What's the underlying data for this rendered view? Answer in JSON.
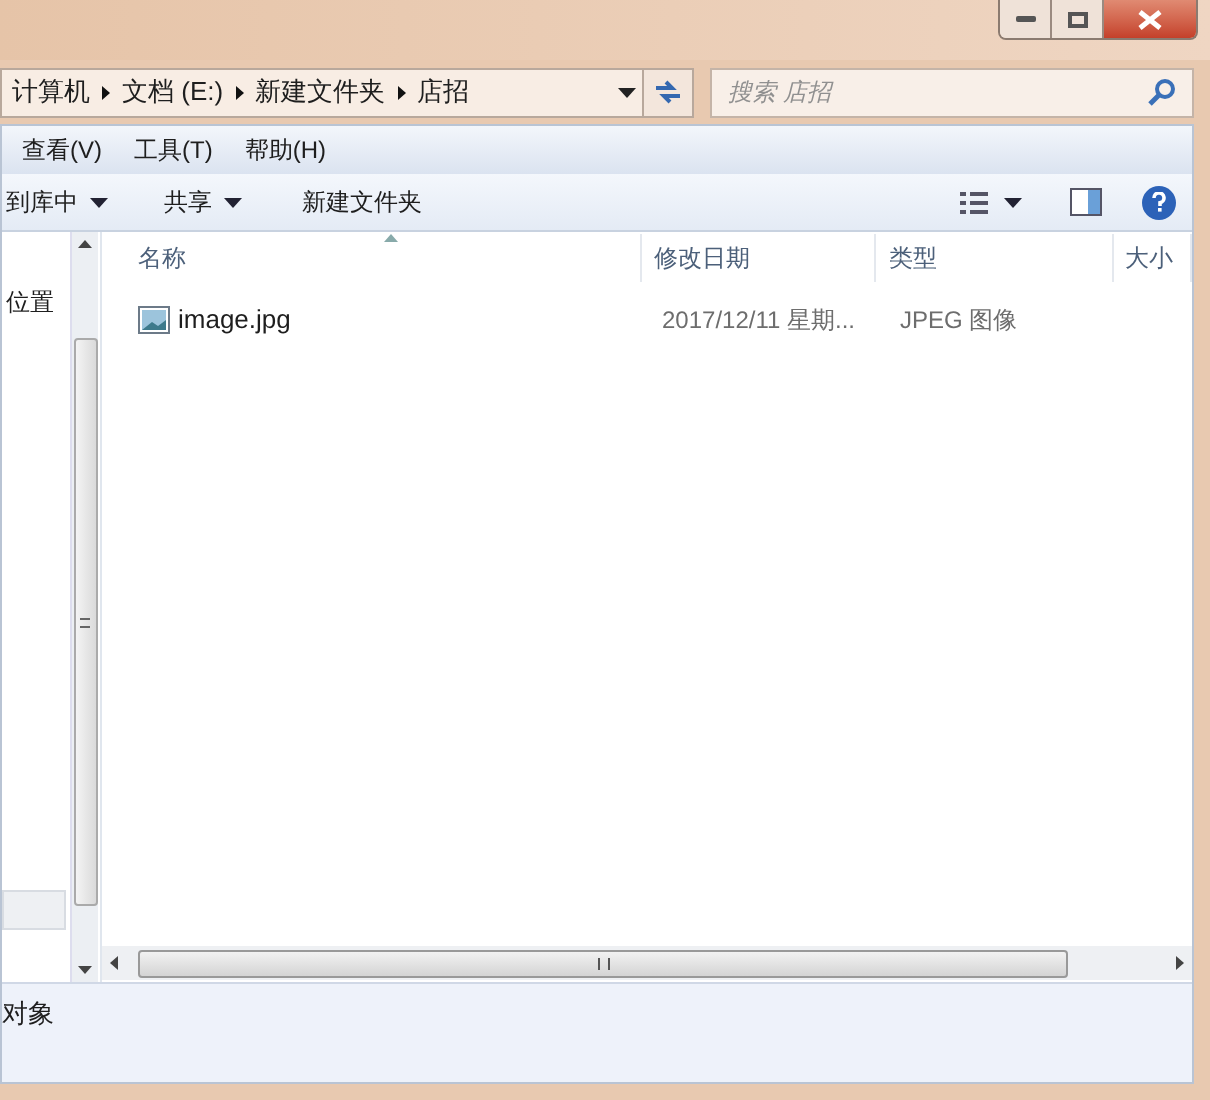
{
  "address_bar": {
    "crumbs": [
      "计算机",
      "文档 (E:)",
      "新建文件夹",
      "店招"
    ]
  },
  "search": {
    "placeholder": "搜索 店招"
  },
  "menu_bar": [
    "查看(V)",
    "工具(T)",
    "帮助(H)"
  ],
  "toolbar": [
    {
      "label": "到库中",
      "dropdown": true
    },
    {
      "label": "共享",
      "dropdown": true
    },
    {
      "label": "新建文件夹",
      "dropdown": false
    }
  ],
  "nav_pane": {
    "items": [
      "位置"
    ]
  },
  "file_list": {
    "columns": [
      {
        "label": "名称",
        "sorted": true
      },
      {
        "label": "修改日期",
        "sorted": false
      },
      {
        "label": "类型",
        "sorted": false
      },
      {
        "label": "大小",
        "sorted": false
      }
    ],
    "rows": [
      {
        "name": "image.jpg",
        "modified": "2017/12/11 星期...",
        "type": "JPEG 图像"
      }
    ]
  },
  "status_bar": {
    "text": "对象"
  }
}
